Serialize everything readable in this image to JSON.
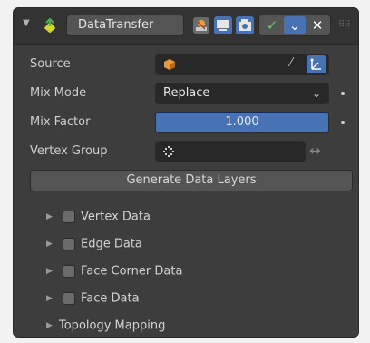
{
  "modifier": {
    "name": "DataTransfer",
    "collapse_icon": "triangle-down-icon",
    "type_icon": "data-transfer-modifier-icon"
  },
  "header_toggles": [
    "edit-mode-cage-icon",
    "realtime-display-icon",
    "render-icon"
  ],
  "header_group": [
    "checkmark-apply-icon",
    "chevron-down-icon",
    "close-x-icon"
  ],
  "properties": {
    "source": {
      "label": "Source",
      "value": "",
      "icon": "object-cube-icon"
    },
    "mix_mode": {
      "label": "Mix Mode",
      "value": "Replace"
    },
    "mix_factor": {
      "label": "Mix Factor",
      "value": "1.000"
    },
    "vertex_group": {
      "label": "Vertex Group",
      "value": ""
    }
  },
  "generate_button": "Generate Data Layers",
  "subpanels": [
    {
      "label": "Vertex Data",
      "checked": false
    },
    {
      "label": "Edge Data",
      "checked": false
    },
    {
      "label": "Face Corner Data",
      "checked": false
    },
    {
      "label": "Face Data",
      "checked": false
    },
    {
      "label": "Topology Mapping"
    }
  ],
  "colors": {
    "accent": "#4772b3",
    "panel_bg": "#3d3d3d",
    "header_bg": "#333333"
  }
}
